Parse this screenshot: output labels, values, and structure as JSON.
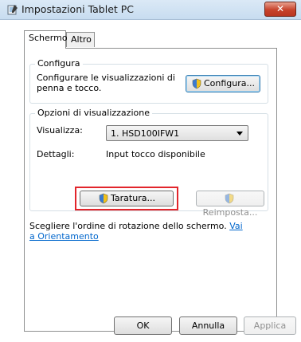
{
  "window": {
    "title": "Impostazioni Tablet PC",
    "close_label": "✕"
  },
  "tabs": [
    {
      "label": "Schermo",
      "active": true
    },
    {
      "label": "Altro",
      "active": false
    }
  ],
  "configura_group": {
    "legend": "Configura",
    "description_line1": "Configurare le visualizzazioni di",
    "description_line2": "penna e tocco.",
    "button_label": "Configura..."
  },
  "display_group": {
    "legend": "Opzioni di visualizzazione",
    "display_label": "Visualizza:",
    "display_value": "1. HSD100IFW1",
    "details_label": "Dettagli:",
    "details_value": "Input tocco disponibile",
    "calibrate_label": "Taratura...",
    "reset_label": "Reimposta..."
  },
  "rotation": {
    "text": "Scegliere l'ordine di rotazione dello schermo.",
    "link_part1": "Vai",
    "link_part2": "a Orientamento"
  },
  "footer": {
    "ok_label": "OK",
    "cancel_label": "Annulla",
    "apply_label": "Applica"
  },
  "colors": {
    "highlight_box": "#e2252b",
    "link": "#0066cc"
  }
}
